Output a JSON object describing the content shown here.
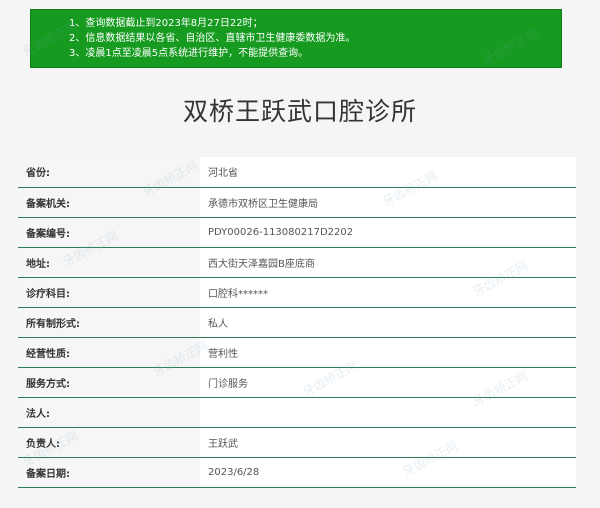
{
  "notice": {
    "lines": [
      "1、查询数据截止到2023年8月27日22时；",
      "2、信息数据结果以各省、自治区、直辖市卫生健康委数据为准。",
      "3、凌晨1点至凌晨5点系统进行维护，不能提供查询。"
    ]
  },
  "clinic": {
    "name": "双桥王跃武口腔诊所"
  },
  "rows": [
    {
      "label": "省份:",
      "value": "河北省"
    },
    {
      "label": "备案机关:",
      "value": "承德市双桥区卫生健康局"
    },
    {
      "label": "备案编号:",
      "value": "PDY00026-113080217D2202"
    },
    {
      "label": "地址:",
      "value": "西大街天泽嘉园B座底商"
    },
    {
      "label": "诊疗科目:",
      "value": "口腔科******"
    },
    {
      "label": "所有制形式:",
      "value": "私人"
    },
    {
      "label": "经营性质:",
      "value": "营利性"
    },
    {
      "label": "服务方式:",
      "value": "门诊服务"
    },
    {
      "label": "法人:",
      "value": ""
    },
    {
      "label": "负责人:",
      "value": "王跃武"
    },
    {
      "label": "备案日期:",
      "value": "2023/6/28"
    }
  ],
  "watermark": {
    "text": "牙齿矫正网"
  }
}
